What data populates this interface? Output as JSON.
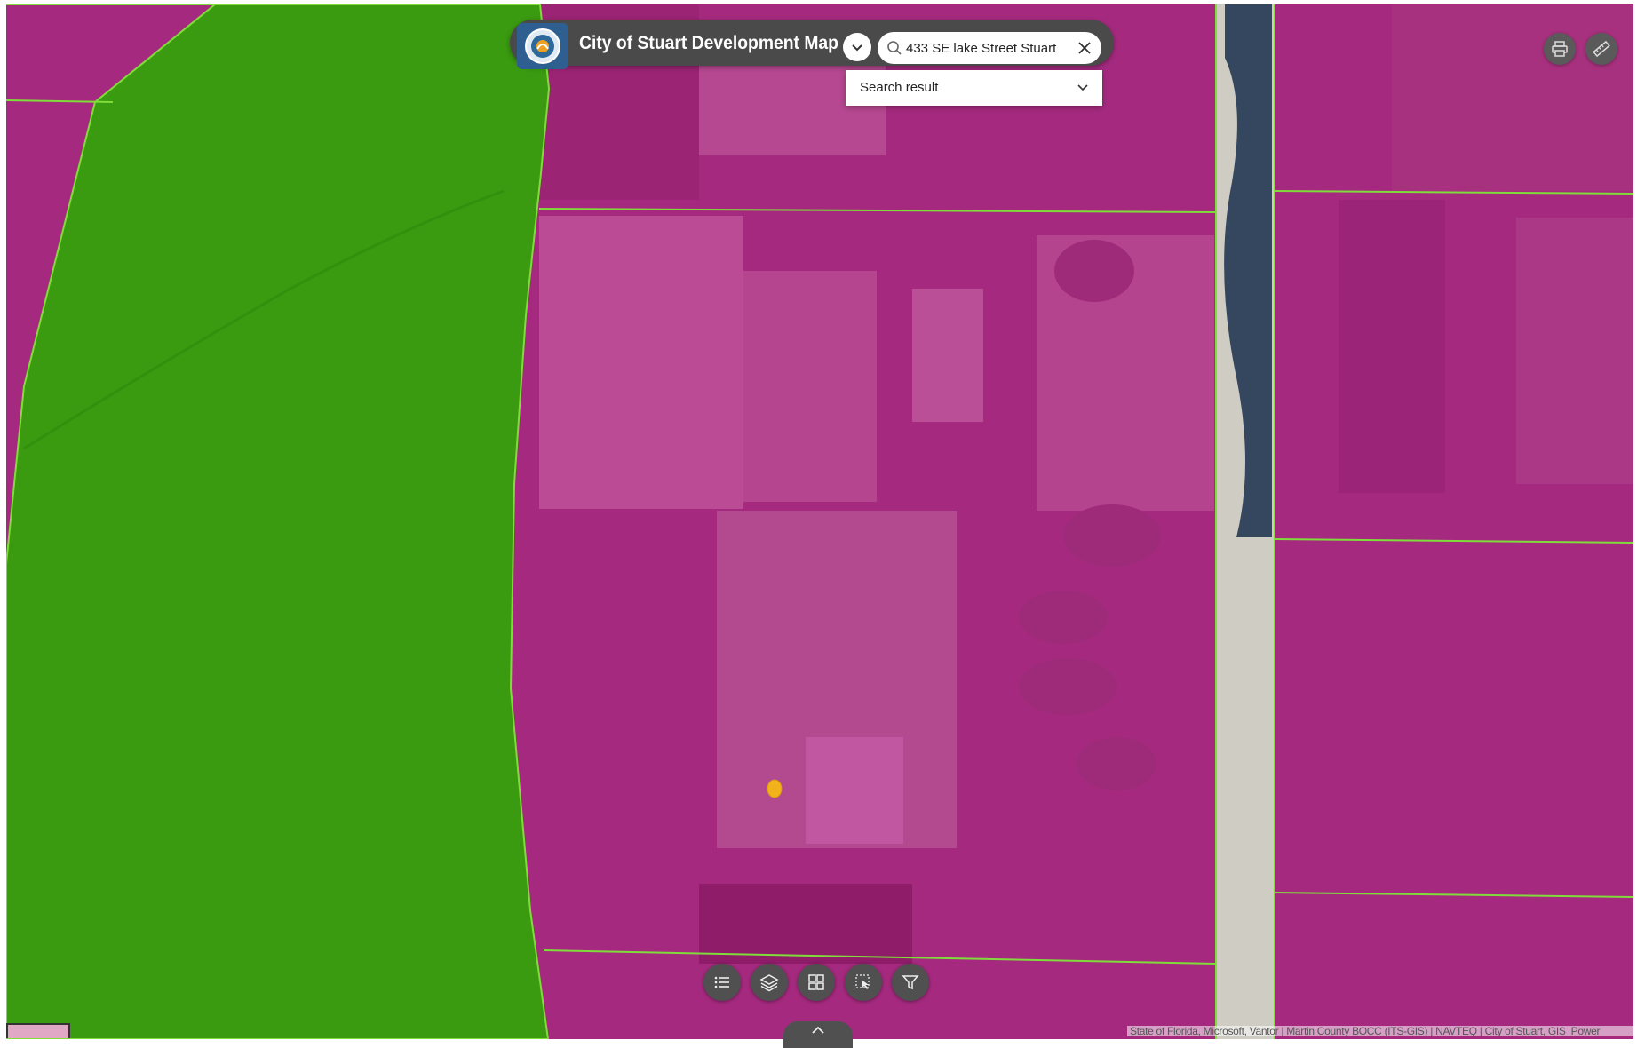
{
  "header": {
    "title": "City of Stuart Development Map",
    "logo_icon": "city-seal-icon"
  },
  "search": {
    "value": "433 SE lake Street Stuart",
    "placeholder": "",
    "result_label": "Search result"
  },
  "tools_top_right": [
    {
      "name": "print",
      "icon": "printer-icon"
    },
    {
      "name": "measure",
      "icon": "ruler-icon"
    }
  ],
  "toolbar": [
    {
      "name": "legend",
      "icon": "list-icon"
    },
    {
      "name": "layers",
      "icon": "layers-icon"
    },
    {
      "name": "basemap-gallery",
      "icon": "grid-icon"
    },
    {
      "name": "select",
      "icon": "select-icon"
    },
    {
      "name": "filter",
      "icon": "filter-icon"
    }
  ],
  "attribution": {
    "text": "State of Florida, Microsoft, Vantor | Martin County BOCC (ITS-GIS) | NAVTEQ | City of Stuart, GIS",
    "powered": "Power"
  },
  "colors": {
    "zoning_magenta": "#a52a7f",
    "zoning_green": "#3a9a10",
    "parcel_line": "#7fdc3a",
    "marker": "#f2b21c",
    "toolbar_bg": "#505050"
  }
}
